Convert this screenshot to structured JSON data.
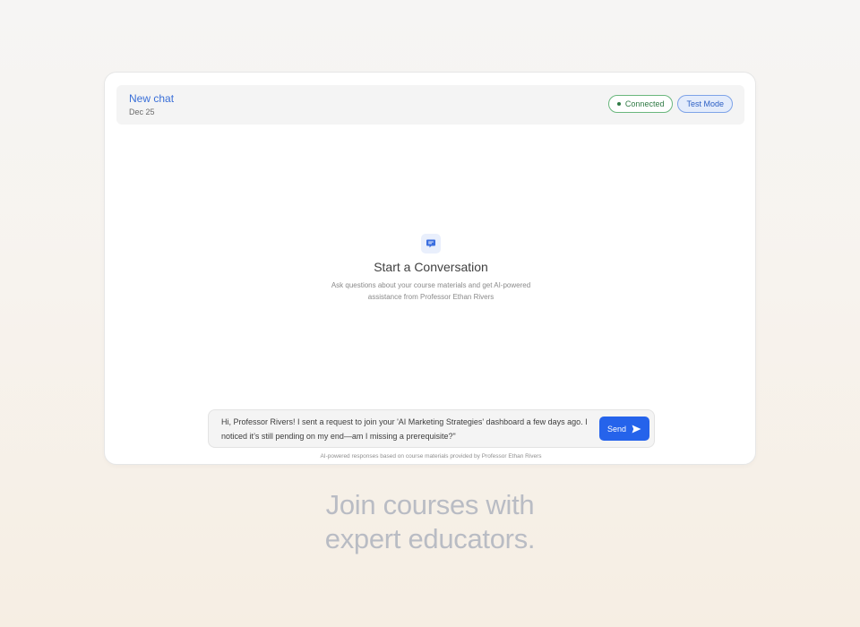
{
  "header": {
    "title": "New chat",
    "date": "Dec 25",
    "badges": {
      "connected": "Connected",
      "test_mode": "Test Mode"
    }
  },
  "empty_state": {
    "icon": "chat-bubble-icon",
    "title": "Start a Conversation",
    "description": "Ask questions about your course materials and get AI-powered assistance from Professor Ethan Rivers"
  },
  "composer": {
    "value": "Hi, Professor Rivers! I sent a request to join your 'AI Marketing Strategies' dashboard a few days ago. I noticed it’s still pending on my end—am I missing a prerequisite?\"",
    "send_label": "Send",
    "send_icon": "send-arrow-icon"
  },
  "footer_note": "AI-powered responses based on course materials provided by Professor Ethan Rivers",
  "tagline": {
    "line1": "Join courses with",
    "line2": "expert educators."
  },
  "colors": {
    "accent": "#2563eb",
    "connected": "#2f7a44",
    "title_link": "#3a6fd8",
    "tagline": "#b9bcc4"
  }
}
